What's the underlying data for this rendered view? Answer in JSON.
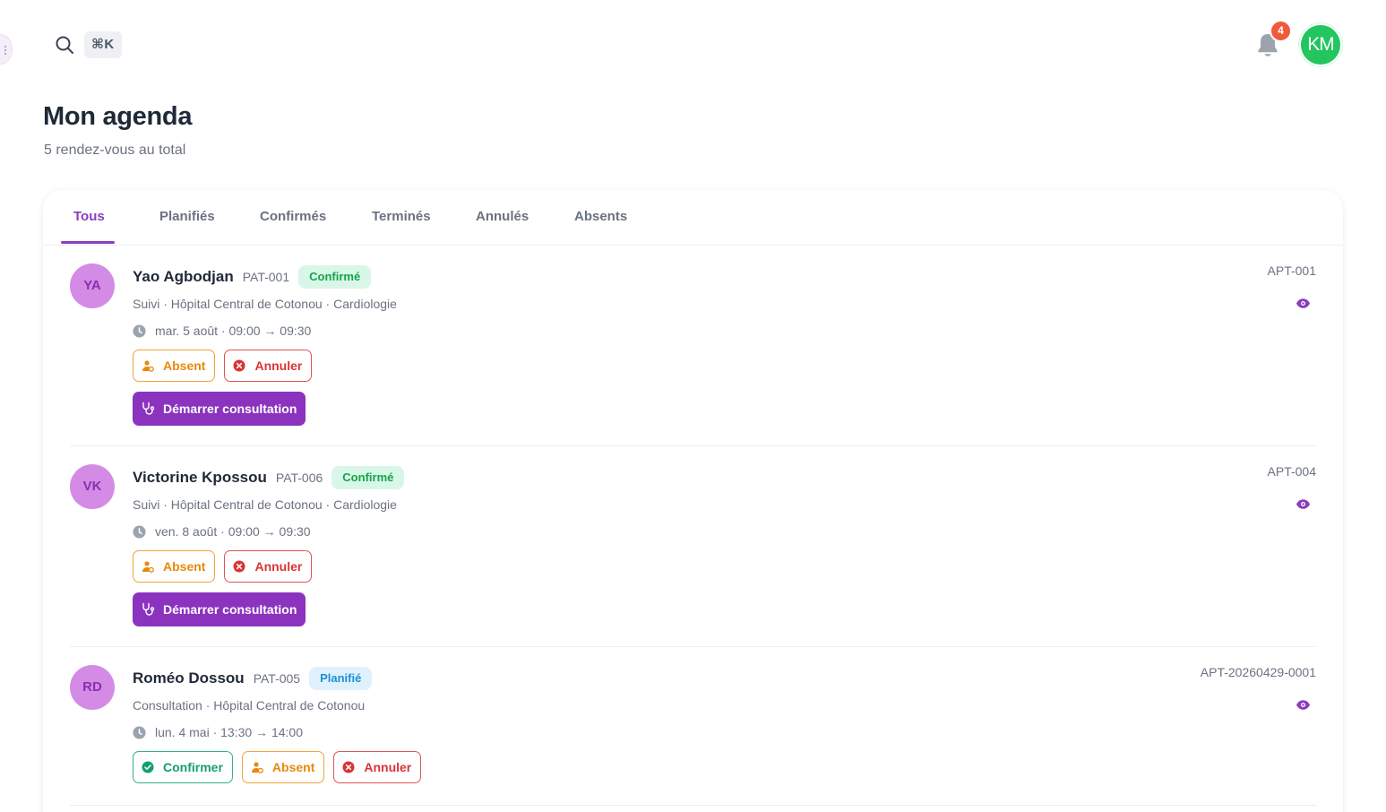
{
  "header": {
    "shortcut": "⌘K",
    "notifications_count": "4",
    "user_initials": "KM"
  },
  "page": {
    "title": "Mon agenda",
    "subtitle": "5 rendez-vous au total"
  },
  "tabs": [
    {
      "label": "Tous",
      "active": true
    },
    {
      "label": "Planifiés",
      "active": false
    },
    {
      "label": "Confirmés",
      "active": false
    },
    {
      "label": "Terminés",
      "active": false
    },
    {
      "label": "Annulés",
      "active": false
    },
    {
      "label": "Absents",
      "active": false
    }
  ],
  "appointments": [
    {
      "initials": "YA",
      "name": "Yao Agbodjan",
      "patient_id": "PAT-001",
      "status": "Confirmé",
      "details": "Suivi · Hôpital Central de Cotonou · Cardiologie",
      "datetime": "mar. 5 août · 09:00 → 09:30",
      "ref": "APT-001",
      "actions": {
        "absent": "Absent",
        "cancel": "Annuler",
        "start": "Démarrer consultation"
      }
    },
    {
      "initials": "VK",
      "name": "Victorine Kpossou",
      "patient_id": "PAT-006",
      "status": "Confirmé",
      "details": "Suivi · Hôpital Central de Cotonou · Cardiologie",
      "datetime": "ven. 8 août · 09:00 → 09:30",
      "ref": "APT-004",
      "actions": {
        "absent": "Absent",
        "cancel": "Annuler",
        "start": "Démarrer consultation"
      }
    },
    {
      "initials": "RD",
      "name": "Roméo Dossou",
      "patient_id": "PAT-005",
      "status": "Planifié",
      "details": "Consultation · Hôpital Central de Cotonou",
      "datetime": "lun. 4 mai · 13:30 → 14:00",
      "ref": "APT-20260429-0001",
      "actions": {
        "confirm": "Confirmer",
        "absent": "Absent",
        "cancel": "Annuler"
      }
    }
  ],
  "colors": {
    "accent": "#8b3dbc",
    "confirmed_bg": "#d9f7e8",
    "confirmed_text": "#16a34a",
    "planned_bg": "#dff1fd",
    "planned_text": "#1e90d6",
    "absent": "#e8890c",
    "cancel": "#d93434",
    "confirm": "#12a06c",
    "notification": "#f05a3a",
    "user_avatar": "#22c55e"
  },
  "icons": [
    "search-icon",
    "bell-icon",
    "clock-icon",
    "eye-icon",
    "user-absent-icon",
    "cancel-circle-icon",
    "check-circle-icon",
    "stethoscope-icon"
  ]
}
